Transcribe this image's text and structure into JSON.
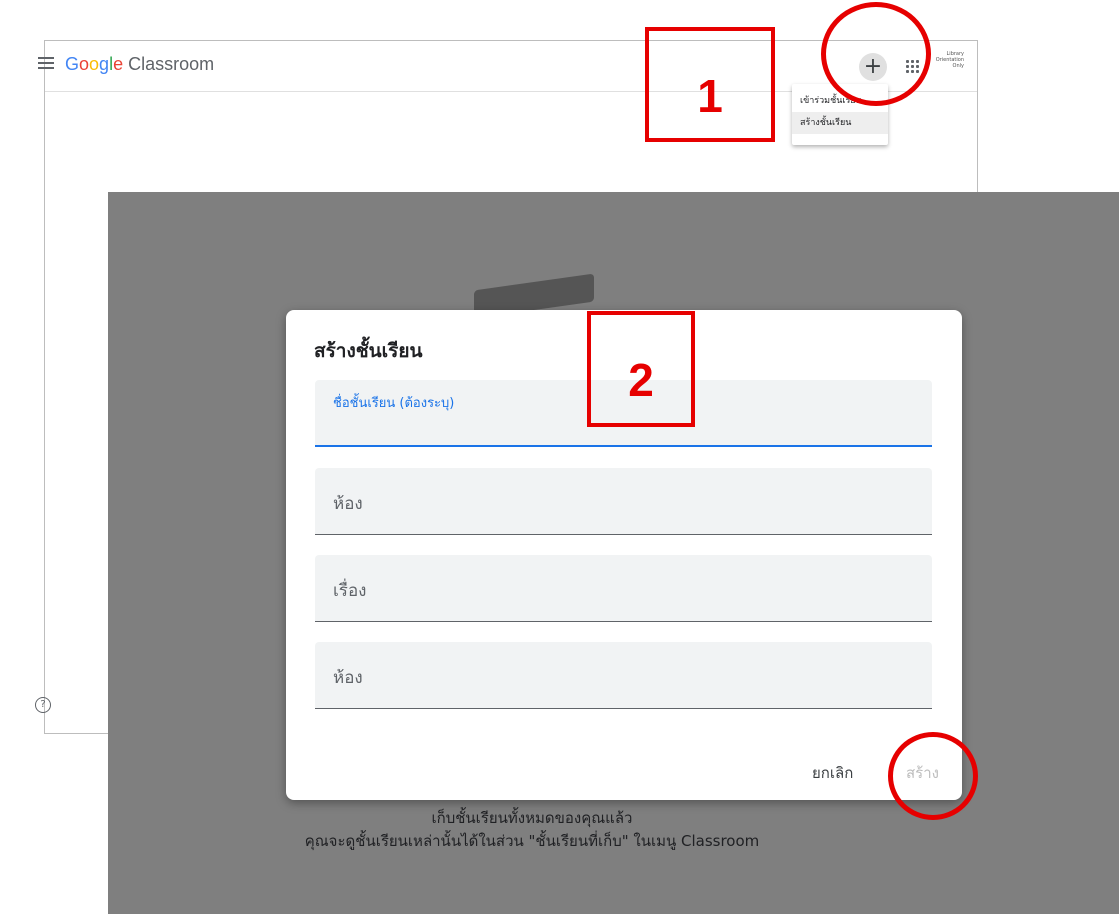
{
  "classroom": {
    "brand": {
      "g1": "G",
      "o1": "o",
      "o2": "o",
      "g2": "g",
      "l": "l",
      "e": "e",
      "suffix": " Classroom"
    },
    "add_label": "+",
    "account_text": "Library Orientation Only",
    "menu_items": [
      "เข้าร่วมชั้นเรียน",
      "สร้างชั้นเรียน"
    ],
    "help_label": "?"
  },
  "dialog": {
    "title": "สร้างชั้นเรียน",
    "fields": [
      {
        "label": "ชื่อชั้นเรียน (ต้องระบุ)"
      },
      {
        "placeholder": "ห้อง"
      },
      {
        "placeholder": "เรื่อง"
      },
      {
        "placeholder": "ห้อง"
      }
    ],
    "cancel_label": "ยกเลิก",
    "create_label": "สร้าง"
  },
  "background": {
    "line1": "เก็บชั้นเรียนทั้งหมดของคุณแล้ว",
    "line2": "คุณจะดูชั้นเรียนเหล่านั้นได้ในส่วน \"ชั้นเรียนที่เก็บ\" ในเมนู Classroom"
  },
  "annotations": {
    "step1": "1",
    "step2": "2"
  },
  "colors": {
    "annotation_red": "#e60000",
    "accent_blue": "#1a73e8",
    "overlay_gray": "#7f7f7f"
  }
}
